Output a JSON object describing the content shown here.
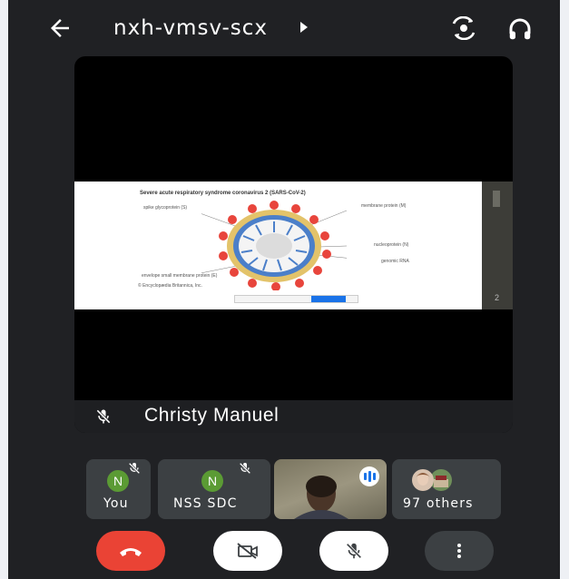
{
  "header": {
    "meeting_code": "nxh-vmsv-scx"
  },
  "presentation": {
    "presenter_name": "Christy Manuel",
    "slide": {
      "title": "Severe acute respiratory syndrome coronavirus 2 (SARS-CoV-2)",
      "labels": {
        "spike": "spike glycoprotein (S)",
        "envelope": "envelope small membrane protein (E)",
        "membrane": "membrane protein (M)",
        "nucleoprotein": "nucleoprotein (N)",
        "rna": "genomic RNA",
        "credit": "© Encyclopædia Britannica, Inc."
      },
      "page_number": "2"
    }
  },
  "participants": [
    {
      "initial": "N",
      "label": "You"
    },
    {
      "initial": "N",
      "label": "NSS SDC"
    },
    {
      "label": ""
    },
    {
      "label": "97 others"
    }
  ],
  "colors": {
    "background": "#202124",
    "tile": "#3c4043",
    "avatar_green": "#5b9b34",
    "end_call_red": "#ea4335",
    "accent_blue": "#1a73e8"
  }
}
